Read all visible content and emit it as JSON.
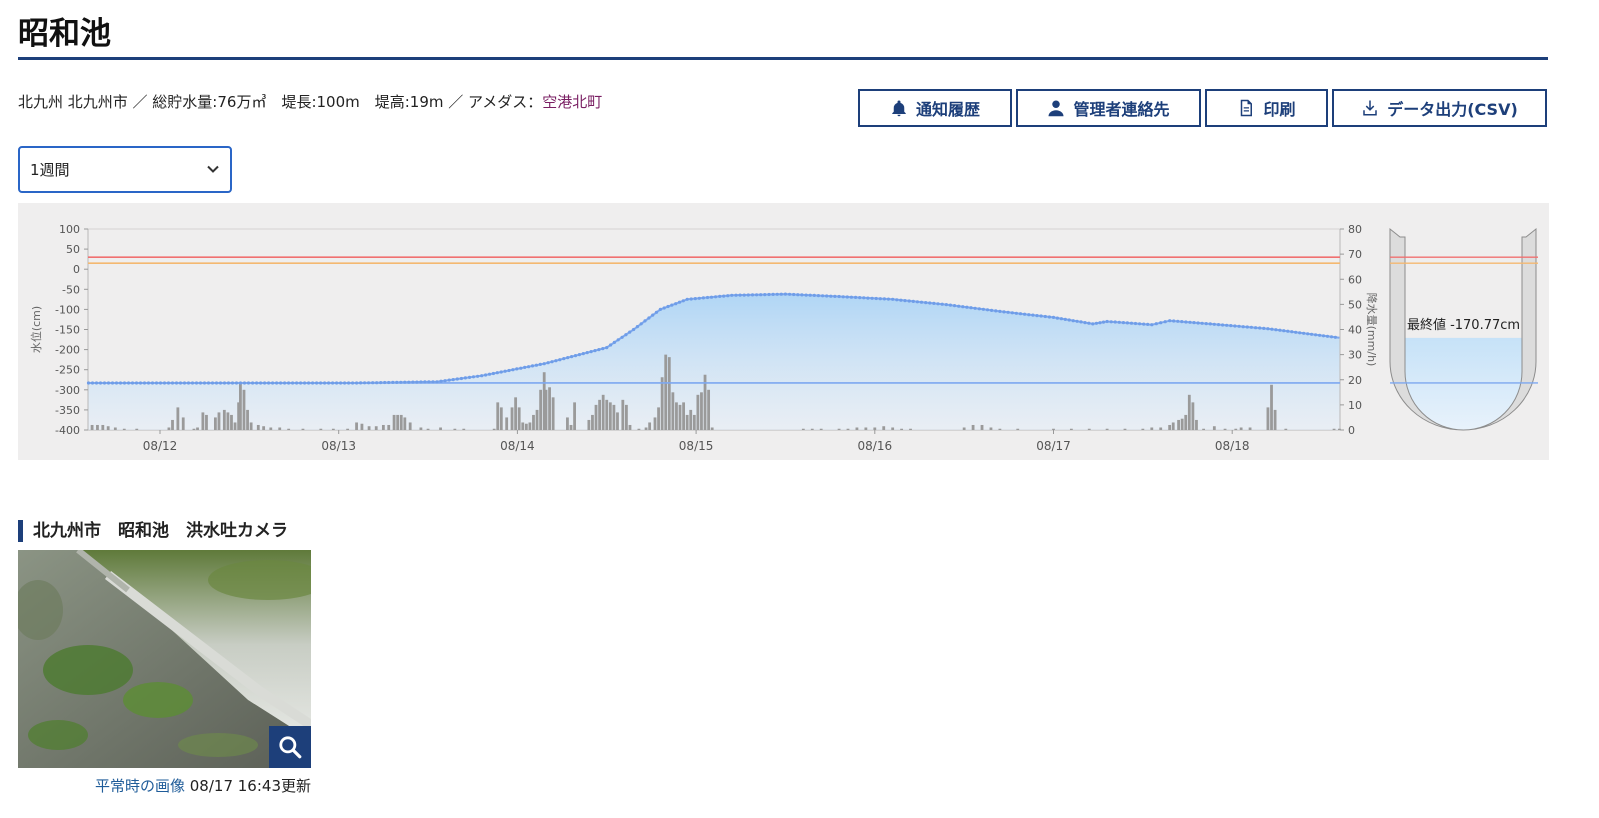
{
  "page": {
    "title": "昭和池",
    "meta_info": "北九州 北九州市 ／ 総貯水量:76万㎥　堤長:100m　堤高:19m ／ アメダス：",
    "amedas_link": "空港北町"
  },
  "actions": {
    "notify_label": "通知履歴",
    "contact_label": "管理者連絡先",
    "print_label": "印刷",
    "csv_label": "データ出力(CSV)"
  },
  "period_select": {
    "value": "1週間"
  },
  "chart_data": {
    "type": "line+bar",
    "x_tick_labels": [
      "08/12",
      "08/13",
      "08/14",
      "08/15",
      "08/16",
      "08/17",
      "08/18"
    ],
    "x_range_days": [
      0,
      7
    ],
    "y_left": {
      "label": "水位(cm)",
      "range": [
        -400,
        100
      ],
      "ticks": [
        100,
        50,
        0,
        -50,
        -100,
        -150,
        -200,
        -250,
        -300,
        -350,
        -400
      ]
    },
    "y_right": {
      "label": "降水量(mm/h)",
      "range": [
        0,
        80
      ],
      "ticks": [
        80,
        70,
        60,
        50,
        40,
        30,
        20,
        10,
        0
      ]
    },
    "reference_lines": [
      {
        "value": 30,
        "color": "#f07070"
      },
      {
        "value": 15,
        "color": "#f4b870"
      },
      {
        "value": -283,
        "color": "#7da7f0"
      }
    ],
    "water_level": {
      "color": "#7ea8ee",
      "x_days": [
        0,
        1.5,
        1.95,
        2.2,
        2.55,
        2.9,
        3.05,
        3.2,
        3.35,
        3.6,
        3.9,
        4.2,
        4.5,
        4.8,
        5.1,
        5.4,
        5.62,
        5.7,
        5.95,
        6.05,
        6.3,
        6.6,
        7.0
      ],
      "values": [
        -283,
        -283,
        -280,
        -265,
        -235,
        -195,
        -150,
        -100,
        -75,
        -65,
        -62,
        -68,
        -75,
        -88,
        -105,
        -120,
        -136,
        -130,
        -138,
        -128,
        -137,
        -148,
        -170.77
      ]
    },
    "rainfall_bars": [
      [
        0.02,
        2
      ],
      [
        0.05,
        2
      ],
      [
        0.08,
        2
      ],
      [
        0.11,
        1.5
      ],
      [
        0.15,
        1
      ],
      [
        0.2,
        0.5
      ],
      [
        0.27,
        0.5
      ],
      [
        0.45,
        1
      ],
      [
        0.47,
        4
      ],
      [
        0.5,
        9
      ],
      [
        0.53,
        5
      ],
      [
        0.59,
        0.5
      ],
      [
        0.61,
        1
      ],
      [
        0.64,
        7
      ],
      [
        0.66,
        6
      ],
      [
        0.71,
        5
      ],
      [
        0.73,
        7
      ],
      [
        0.76,
        8
      ],
      [
        0.78,
        7
      ],
      [
        0.8,
        6
      ],
      [
        0.82,
        3
      ],
      [
        0.84,
        11
      ],
      [
        0.85,
        19
      ],
      [
        0.87,
        16
      ],
      [
        0.89,
        8
      ],
      [
        0.91,
        3
      ],
      [
        0.95,
        2
      ],
      [
        0.98,
        1.5
      ],
      [
        1.02,
        1
      ],
      [
        1.07,
        1
      ],
      [
        1.12,
        0.5
      ],
      [
        1.2,
        0.5
      ],
      [
        1.3,
        0.5
      ],
      [
        1.37,
        0.5
      ],
      [
        1.45,
        0.5
      ],
      [
        1.5,
        3
      ],
      [
        1.53,
        2.5
      ],
      [
        1.57,
        1.5
      ],
      [
        1.61,
        1.5
      ],
      [
        1.65,
        2
      ],
      [
        1.68,
        2
      ],
      [
        1.71,
        6
      ],
      [
        1.73,
        6
      ],
      [
        1.75,
        6
      ],
      [
        1.77,
        5
      ],
      [
        1.8,
        3
      ],
      [
        1.86,
        1
      ],
      [
        1.9,
        0.5
      ],
      [
        1.97,
        1
      ],
      [
        2.05,
        0.5
      ],
      [
        2.1,
        0.5
      ],
      [
        2.27,
        0.5
      ],
      [
        2.29,
        11
      ],
      [
        2.31,
        9
      ],
      [
        2.34,
        5
      ],
      [
        2.37,
        9
      ],
      [
        2.39,
        13
      ],
      [
        2.41,
        9
      ],
      [
        2.43,
        3
      ],
      [
        2.45,
        2.5
      ],
      [
        2.47,
        3
      ],
      [
        2.49,
        6
      ],
      [
        2.51,
        8
      ],
      [
        2.53,
        16
      ],
      [
        2.55,
        23
      ],
      [
        2.56,
        16
      ],
      [
        2.58,
        17
      ],
      [
        2.6,
        13
      ],
      [
        2.68,
        5
      ],
      [
        2.7,
        2
      ],
      [
        2.72,
        11
      ],
      [
        2.8,
        4
      ],
      [
        2.82,
        6
      ],
      [
        2.84,
        10
      ],
      [
        2.86,
        12
      ],
      [
        2.88,
        14
      ],
      [
        2.9,
        12
      ],
      [
        2.92,
        11
      ],
      [
        2.94,
        10
      ],
      [
        2.96,
        7
      ],
      [
        2.99,
        12
      ],
      [
        3.01,
        10
      ],
      [
        3.03,
        2
      ],
      [
        3.08,
        0.5
      ],
      [
        3.12,
        1
      ],
      [
        3.14,
        3
      ],
      [
        3.17,
        5
      ],
      [
        3.19,
        9
      ],
      [
        3.21,
        21
      ],
      [
        3.23,
        30
      ],
      [
        3.25,
        29
      ],
      [
        3.27,
        15
      ],
      [
        3.29,
        11
      ],
      [
        3.31,
        10
      ],
      [
        3.33,
        11
      ],
      [
        3.35,
        6
      ],
      [
        3.37,
        8
      ],
      [
        3.39,
        6
      ],
      [
        3.41,
        14
      ],
      [
        3.43,
        15
      ],
      [
        3.45,
        22
      ],
      [
        3.47,
        16
      ],
      [
        3.49,
        1
      ],
      [
        4.0,
        0.5
      ],
      [
        4.05,
        0.5
      ],
      [
        4.1,
        0.5
      ],
      [
        4.2,
        0.5
      ],
      [
        4.25,
        0.5
      ],
      [
        4.3,
        1
      ],
      [
        4.35,
        1
      ],
      [
        4.4,
        1
      ],
      [
        4.45,
        1.5
      ],
      [
        4.5,
        1
      ],
      [
        4.55,
        0.5
      ],
      [
        4.6,
        0.5
      ],
      [
        4.9,
        1
      ],
      [
        4.95,
        2
      ],
      [
        5.0,
        2
      ],
      [
        5.05,
        1
      ],
      [
        5.1,
        0.5
      ],
      [
        5.2,
        0.5
      ],
      [
        5.4,
        0.5
      ],
      [
        5.5,
        0.5
      ],
      [
        5.6,
        0.5
      ],
      [
        5.7,
        0.5
      ],
      [
        5.8,
        0.5
      ],
      [
        5.9,
        0.5
      ],
      [
        5.95,
        1
      ],
      [
        6.0,
        1
      ],
      [
        6.05,
        2
      ],
      [
        6.07,
        3
      ],
      [
        6.1,
        4
      ],
      [
        6.12,
        4.5
      ],
      [
        6.14,
        6
      ],
      [
        6.16,
        14
      ],
      [
        6.18,
        11
      ],
      [
        6.2,
        4
      ],
      [
        6.24,
        0.5
      ],
      [
        6.3,
        1.5
      ],
      [
        6.36,
        0.5
      ],
      [
        6.42,
        0.5
      ],
      [
        6.45,
        1
      ],
      [
        6.5,
        1
      ],
      [
        6.6,
        9
      ],
      [
        6.62,
        18
      ],
      [
        6.64,
        8
      ],
      [
        6.7,
        0.5
      ],
      [
        6.97,
        0.5
      ],
      [
        7.0,
        0.5
      ]
    ],
    "rainfall_color": "#9a9a9a"
  },
  "gauge": {
    "latest_label": "最終値 -170.77cm",
    "latest_value": -170.77
  },
  "camera": {
    "heading": "北九州市　昭和池　洪水吐カメラ",
    "normal_image_link": "平常時の画像",
    "updated_text": "08/17 16:43更新"
  }
}
